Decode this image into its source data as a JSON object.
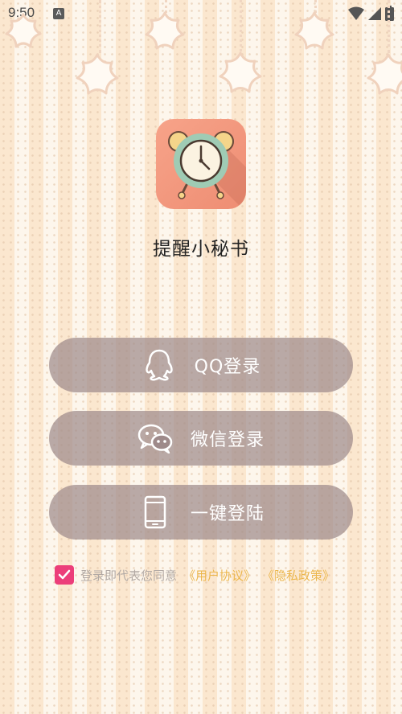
{
  "status_bar": {
    "time": "9:50",
    "notification_icon": "a-icon"
  },
  "app": {
    "title": "提醒小秘书"
  },
  "buttons": [
    {
      "label": "QQ登录",
      "icon": "qq-penguin-icon"
    },
    {
      "label": "微信登录",
      "icon": "wechat-icon"
    },
    {
      "label": "一键登陆",
      "icon": "phone-icon"
    }
  ],
  "agreement": {
    "checked": true,
    "text": "登录即代表您同意",
    "user_agreement": "《用户协议》",
    "privacy_policy": "《隐私政策》"
  },
  "colors": {
    "checkbox": "#ec3e7a",
    "link": "#ecb64c",
    "logo": "#f29a80",
    "button": "#a08a8a"
  }
}
